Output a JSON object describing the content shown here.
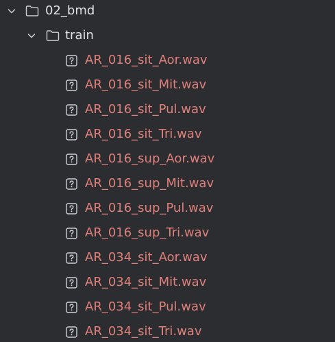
{
  "colors": {
    "background": "#2b2d30",
    "folder_text": "#dfe1e5",
    "file_text": "#e0807b",
    "icon_stroke": "#ced0d6"
  },
  "tree": {
    "root": {
      "label": "02_bmd",
      "icon": "folder-icon",
      "expanded": true
    },
    "child_folder": {
      "label": "train",
      "icon": "folder-icon",
      "expanded": true
    },
    "files": [
      {
        "label": "AR_016_sit_Aor.wav",
        "icon": "unknown-file-icon"
      },
      {
        "label": "AR_016_sit_Mit.wav",
        "icon": "unknown-file-icon"
      },
      {
        "label": "AR_016_sit_Pul.wav",
        "icon": "unknown-file-icon"
      },
      {
        "label": "AR_016_sit_Tri.wav",
        "icon": "unknown-file-icon"
      },
      {
        "label": "AR_016_sup_Aor.wav",
        "icon": "unknown-file-icon"
      },
      {
        "label": "AR_016_sup_Mit.wav",
        "icon": "unknown-file-icon"
      },
      {
        "label": "AR_016_sup_Pul.wav",
        "icon": "unknown-file-icon"
      },
      {
        "label": "AR_016_sup_Tri.wav",
        "icon": "unknown-file-icon"
      },
      {
        "label": "AR_034_sit_Aor.wav",
        "icon": "unknown-file-icon"
      },
      {
        "label": "AR_034_sit_Mit.wav",
        "icon": "unknown-file-icon"
      },
      {
        "label": "AR_034_sit_Pul.wav",
        "icon": "unknown-file-icon"
      },
      {
        "label": "AR_034_sit_Tri.wav",
        "icon": "unknown-file-icon"
      }
    ]
  }
}
